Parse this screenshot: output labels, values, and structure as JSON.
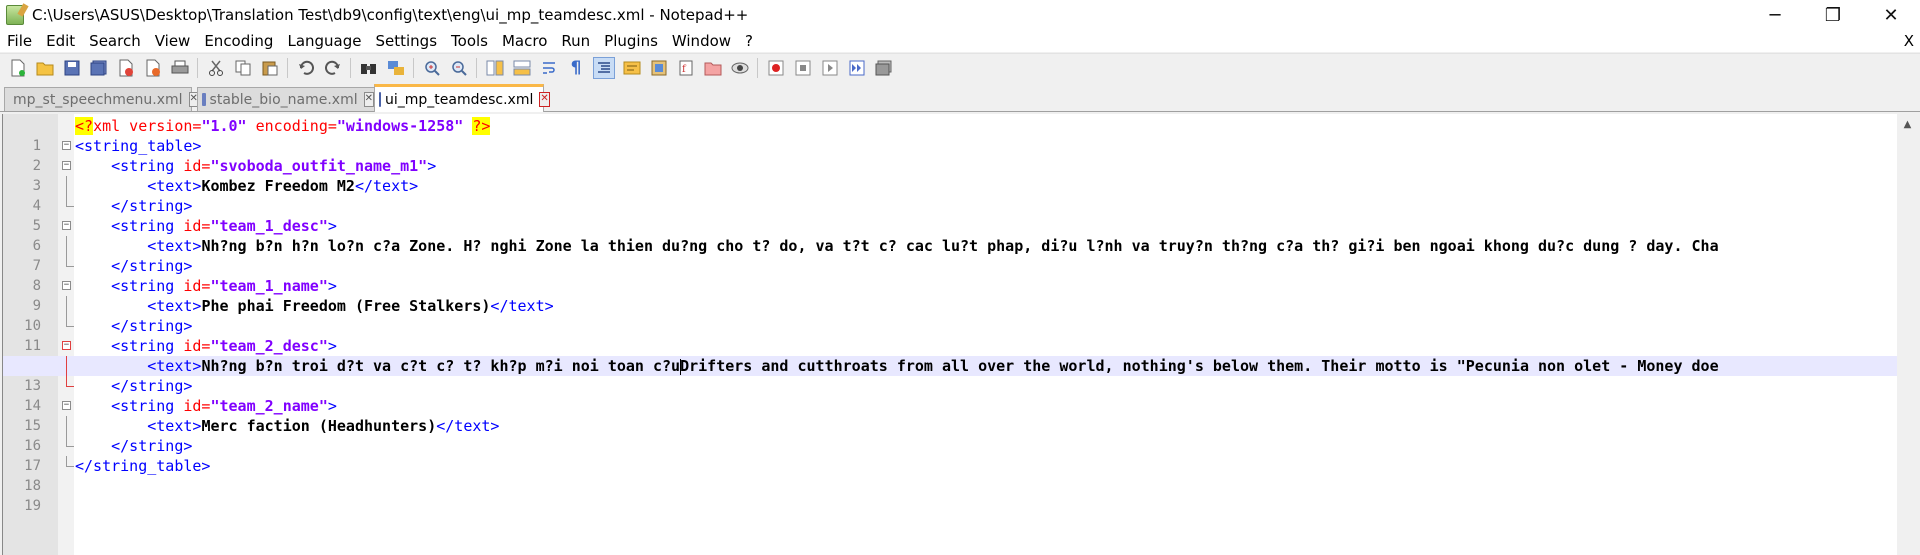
{
  "window": {
    "title": "C:\\Users\\ASUS\\Desktop\\Translation Test\\db9\\config\\text\\eng\\ui_mp_teamdesc.xml - Notepad++",
    "minimize": "─",
    "restore": "❐",
    "close": "✕"
  },
  "menu": {
    "items": [
      "File",
      "Edit",
      "Search",
      "View",
      "Encoding",
      "Language",
      "Settings",
      "Tools",
      "Macro",
      "Run",
      "Plugins",
      "Window",
      "?"
    ],
    "close": "X"
  },
  "toolbar": {
    "buttons": [
      "new-file-icon",
      "open-file-icon",
      "save-icon",
      "save-all-icon",
      "close-icon",
      "close-all-icon",
      "print-icon",
      "cut-icon",
      "copy-icon",
      "paste-icon",
      "undo-icon",
      "redo-icon",
      "find-icon",
      "replace-icon",
      "zoom-in-icon",
      "zoom-out-icon",
      "sync-vertical-icon",
      "sync-horizontal-icon",
      "word-wrap-icon",
      "show-all-chars-icon",
      "indent-guide-icon",
      "udl-icon",
      "doc-map-icon",
      "function-list-icon",
      "folder-workspace-icon",
      "monitor-icon",
      "record-macro-icon",
      "stop-record-icon",
      "play-macro-icon",
      "run-macro-multiple-icon",
      "save-macro-icon"
    ]
  },
  "tabs": [
    {
      "label": "mp_st_speechmenu.xml",
      "active": false,
      "close": "✕"
    },
    {
      "label": "stable_bio_name.xml",
      "active": false,
      "close": "✕"
    },
    {
      "label": "ui_mp_teamdesc.xml",
      "active": true,
      "close": "✕"
    }
  ],
  "editor": {
    "lines": [
      {
        "n": "1",
        "decl_open": "<?",
        "decl_name": "xml",
        "attr1": " version=",
        "val1": "\"1.0\"",
        "attr2": " encoding=",
        "val2": "\"windows-1258\"",
        "decl_close": "?>"
      },
      {
        "n": "2",
        "tag": "<string_table>"
      },
      {
        "n": "3",
        "tag_open": "<string",
        "attr": " id=",
        "val": "\"svoboda_outfit_name_m1\"",
        "tag_close": ">"
      },
      {
        "n": "4",
        "open": "<text>",
        "text": "Kombez Freedom M2",
        "close": "</text>"
      },
      {
        "n": "5",
        "tag": "</string>"
      },
      {
        "n": "6",
        "tag_open": "<string",
        "attr": " id=",
        "val": "\"team_1_desc\"",
        "tag_close": ">"
      },
      {
        "n": "7",
        "open": "<text>",
        "text": "Nh?ng b?n h?n lo?n c?a Zone. H? nghi Zone la thien du?ng cho t? do, va t?t c? cac lu?t phap, di?u l?nh va truy?n th?ng c?a th? gi?i ben ngoai khong du?c dung ? day. Cha",
        "close": ""
      },
      {
        "n": "8",
        "tag": "</string>"
      },
      {
        "n": "9",
        "tag_open": "<string",
        "attr": " id=",
        "val": "\"team_1_name\"",
        "tag_close": ">"
      },
      {
        "n": "10",
        "open": "<text>",
        "text": "Phe phai Freedom (Free Stalkers)",
        "close": "</text>"
      },
      {
        "n": "11",
        "tag": "</string>"
      },
      {
        "n": "12",
        "tag_open": "<string",
        "attr": " id=",
        "val": "\"team_2_desc\"",
        "tag_close": ">"
      },
      {
        "n": "13",
        "open": "<text>",
        "text_a": "Nh?ng b?n troi d?t va c?t c? t? kh?p m?i noi toan c?u",
        "text_b": "Drifters and cutthroats from all over the world, nothing's below them. Their motto is \"Pecunia non olet - Money doe",
        "close": ""
      },
      {
        "n": "14",
        "tag": "</string>"
      },
      {
        "n": "15",
        "tag_open": "<string",
        "attr": " id=",
        "val": "\"team_2_name\"",
        "tag_close": ">"
      },
      {
        "n": "16",
        "open": "<text>",
        "text": "Merc faction (Headhunters)",
        "close": "</text>"
      },
      {
        "n": "17",
        "tag": "</string>"
      },
      {
        "n": "18",
        "tag": "</string_table>"
      },
      {
        "n": "19"
      }
    ]
  }
}
